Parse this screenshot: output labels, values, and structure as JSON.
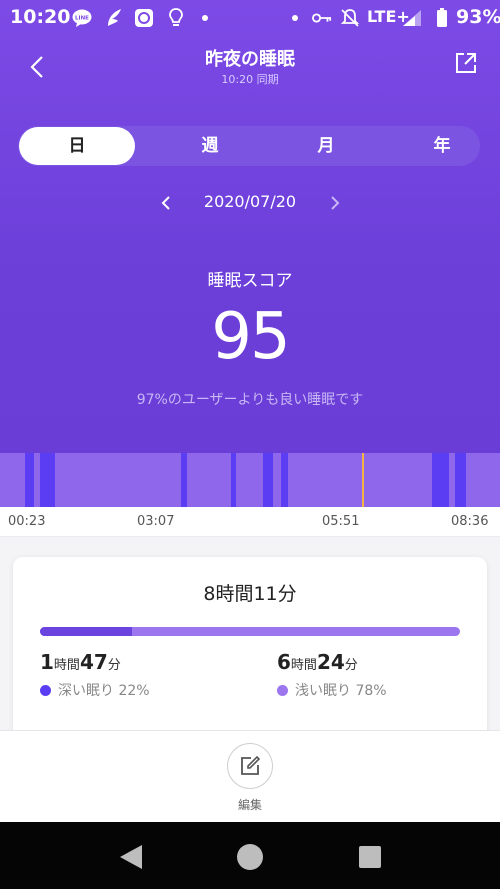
{
  "status_bar": {
    "time": "10:20",
    "network": "LTE+",
    "battery": "93%",
    "icons": [
      "line-icon",
      "wing-icon",
      "app-icon",
      "bulb-icon",
      "dot-icon",
      "dot-icon",
      "key-icon",
      "mute-icon",
      "signal-icon",
      "battery-icon"
    ]
  },
  "header": {
    "title": "昨夜の睡眠",
    "sync_text": "10:20 同期"
  },
  "tabs": [
    {
      "label": "日",
      "active": true
    },
    {
      "label": "週",
      "active": false
    },
    {
      "label": "月",
      "active": false
    },
    {
      "label": "年",
      "active": false
    }
  ],
  "date": {
    "current": "2020/07/20"
  },
  "score": {
    "label": "睡眠スコア",
    "value": "95",
    "comparison": "97%のユーザーよりも良い睡眠です"
  },
  "timeline": {
    "ticks": [
      "00:23",
      "03:07",
      "05:51",
      "08:36"
    ],
    "deep_segments_hhmm": [
      [
        "00:35",
        "00:44"
      ],
      [
        "00:51",
        "01:07"
      ],
      [
        "03:20",
        "03:27"
      ],
      [
        "04:14",
        "04:19"
      ],
      [
        "04:48",
        "04:58"
      ],
      [
        "05:07",
        "05:14"
      ],
      [
        "07:47",
        "08:05"
      ],
      [
        "08:12",
        "08:23"
      ]
    ],
    "marker_time": "06:33"
  },
  "summary": {
    "total": "8時間11分",
    "deep_fraction": 0.22,
    "deep": {
      "hours": "1",
      "minutes": "47",
      "h_unit": "時間",
      "m_unit": "分",
      "label": "深い眠り 22%"
    },
    "light": {
      "hours": "6",
      "minutes": "24",
      "h_unit": "時間",
      "m_unit": "分",
      "label": "浅い眠り 78%"
    }
  },
  "footer": {
    "edit_label": "編集"
  },
  "colors": {
    "header_purple": "#6c3fd9",
    "deep_sleep": "#5b3df4",
    "light_sleep": "#8f67ea",
    "marker": "#f5b342"
  }
}
